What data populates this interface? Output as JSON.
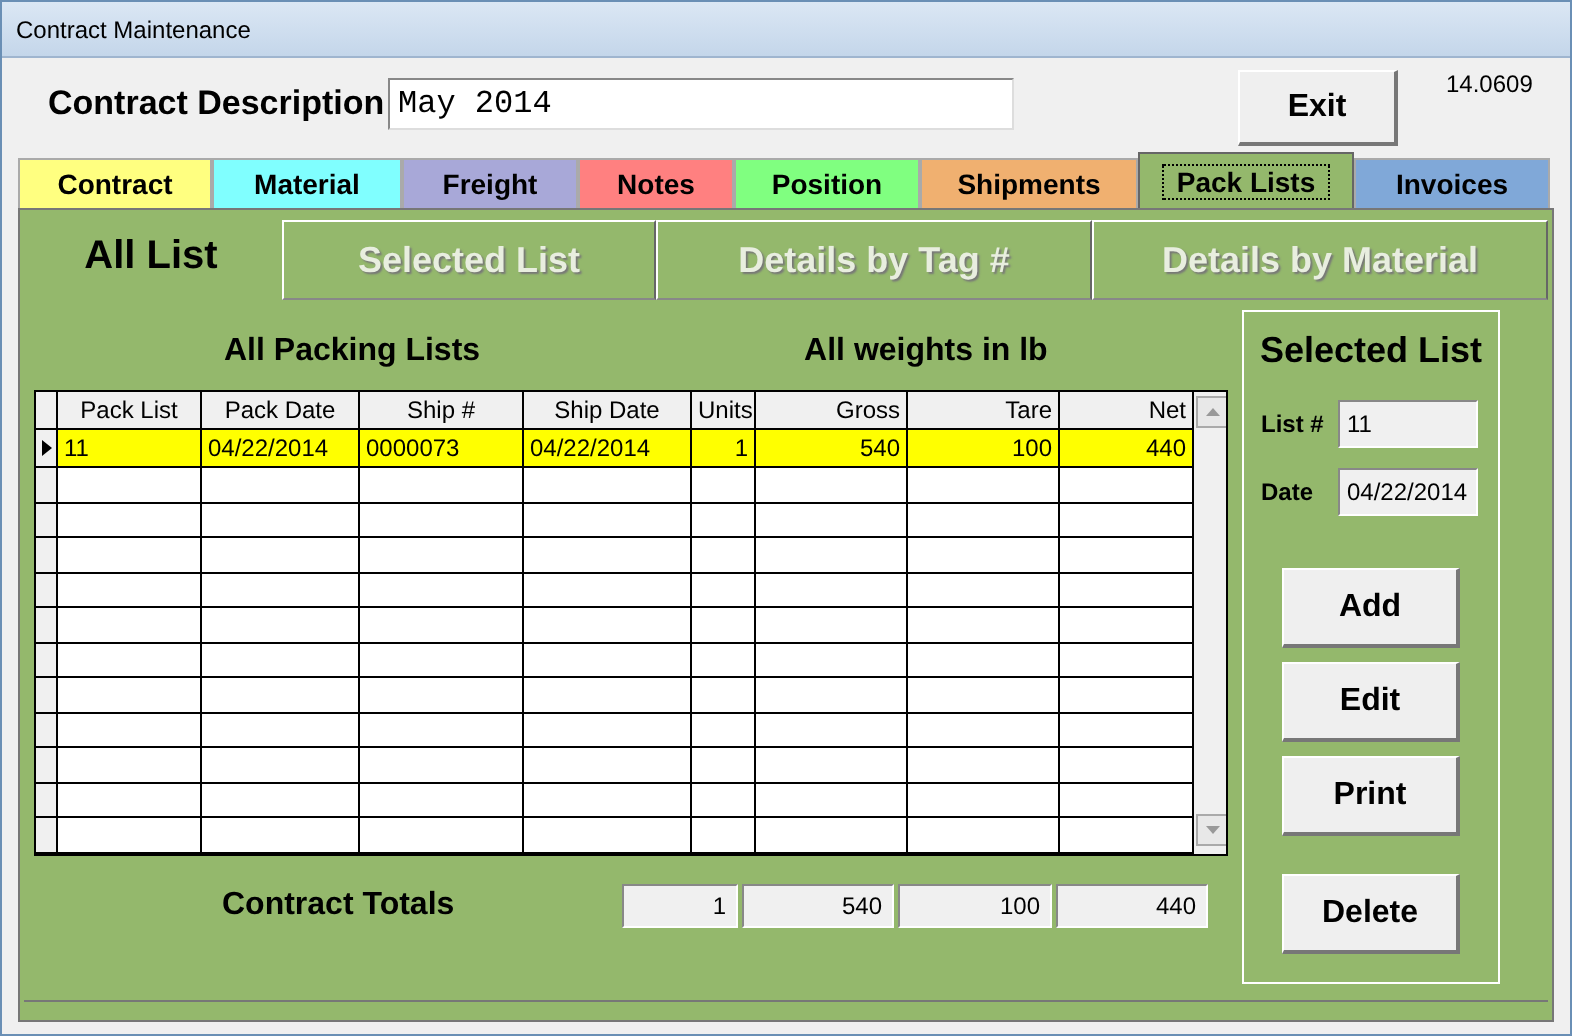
{
  "window": {
    "title": "Contract Maintenance"
  },
  "header": {
    "label": "Contract Description",
    "value": "May 2014",
    "exit_button": "Exit",
    "version": "14.0609"
  },
  "tabs": [
    {
      "label": "Contract",
      "color": "#ffff80",
      "selected": false
    },
    {
      "label": "Material",
      "color": "#80ffff",
      "selected": false
    },
    {
      "label": "Freight",
      "color": "#a8a8d8",
      "selected": false
    },
    {
      "label": "Notes",
      "color": "#ff8080",
      "selected": false
    },
    {
      "label": "Position",
      "color": "#80ff80",
      "selected": false
    },
    {
      "label": "Shipments",
      "color": "#f0b070",
      "selected": false
    },
    {
      "label": "Pack Lists",
      "color": "#94b86c",
      "selected": true
    },
    {
      "label": "Invoices",
      "color": "#80a8d8",
      "selected": false
    }
  ],
  "sub_tabs": [
    {
      "label": "All List",
      "selected": true
    },
    {
      "label": "Selected List",
      "selected": false
    },
    {
      "label": "Details by Tag #",
      "selected": false
    },
    {
      "label": "Details by Material",
      "selected": false
    }
  ],
  "list_title": "All Packing Lists",
  "weights_note": "All weights in lb",
  "table": {
    "columns": [
      "Pack List",
      "Pack Date",
      "Ship #",
      "Ship Date",
      "Units",
      "Gross",
      "Tare",
      "Net"
    ],
    "rows": [
      {
        "cells": [
          "11",
          "04/22/2014",
          "0000073",
          "04/22/2014",
          "1",
          "540",
          "100",
          "440"
        ],
        "selected": true
      }
    ]
  },
  "totals": {
    "label": "Contract Totals",
    "values": [
      "1",
      "540",
      "100",
      "440"
    ]
  },
  "selected_list": {
    "title": "Selected List",
    "list_label": "List #",
    "list_value": "11",
    "date_label": "Date",
    "date_value": "04/22/2014",
    "buttons": [
      "Add",
      "Edit",
      "Print",
      "Delete"
    ]
  }
}
